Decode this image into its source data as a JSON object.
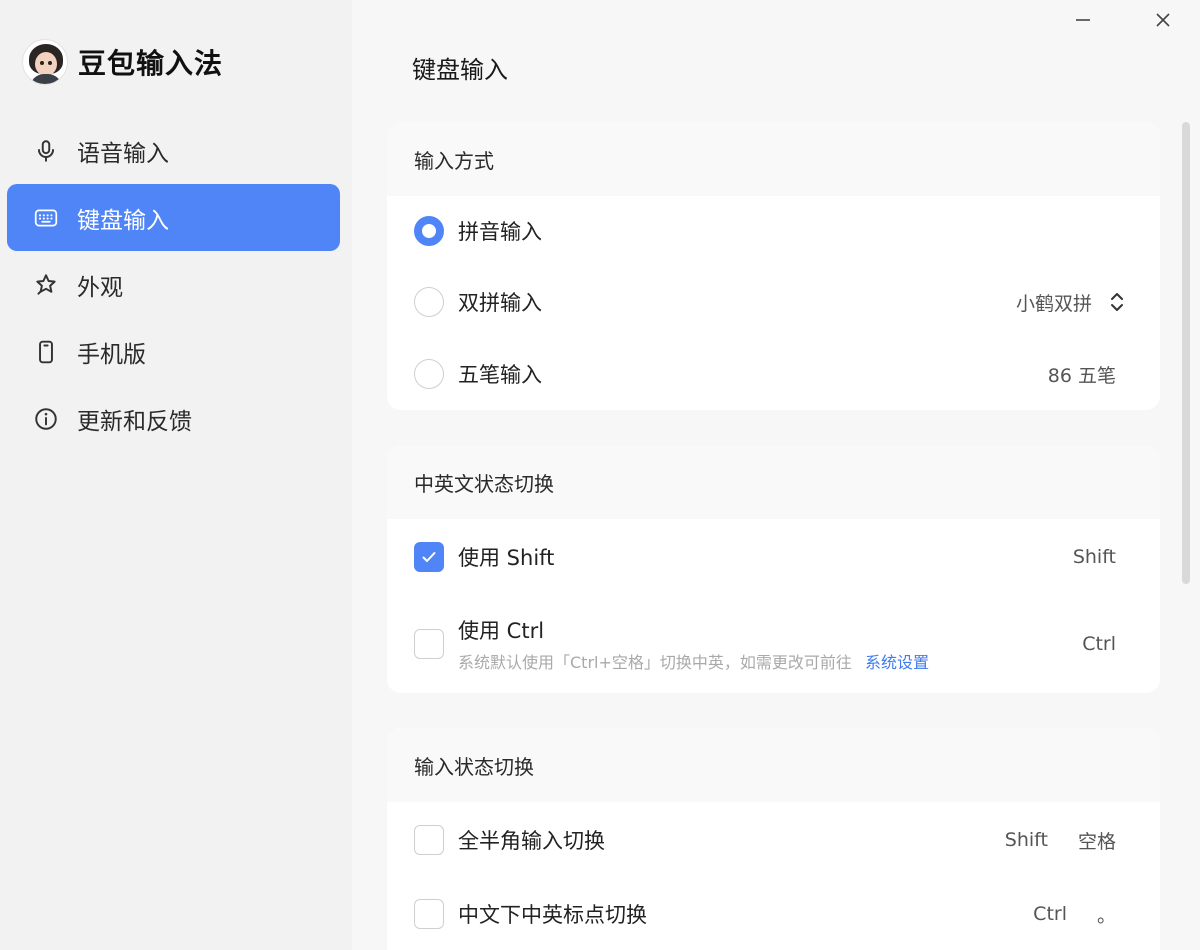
{
  "app": {
    "name": "豆包输入法"
  },
  "sidebar": {
    "items": [
      {
        "label": "语音输入",
        "icon": "microphone-icon"
      },
      {
        "label": "键盘输入",
        "icon": "keyboard-icon",
        "active": true
      },
      {
        "label": "外观",
        "icon": "star-outline-icon"
      },
      {
        "label": "手机版",
        "icon": "phone-icon"
      },
      {
        "label": "更新和反馈",
        "icon": "info-icon"
      }
    ]
  },
  "main": {
    "title": "键盘输入",
    "input_method": {
      "heading": "输入方式",
      "options": [
        {
          "label": "拼音输入",
          "selected": true
        },
        {
          "label": "双拼输入",
          "selected": false,
          "value": "小鹤双拼"
        },
        {
          "label": "五笔输入",
          "selected": false,
          "value": "86 五笔"
        }
      ]
    },
    "cn_en_switch": {
      "heading": "中英文状态切换",
      "options": [
        {
          "label": "使用 Shift",
          "checked": true,
          "key": "Shift"
        },
        {
          "label": "使用 Ctrl",
          "checked": false,
          "key": "Ctrl",
          "note": "系统默认使用「Ctrl+空格」切换中英，如需更改可前往",
          "link": "系统设置"
        }
      ]
    },
    "state_switch": {
      "heading": "输入状态切换",
      "options": [
        {
          "label": "全半角输入切换",
          "checked": false,
          "key1": "Shift",
          "key2": "空格"
        },
        {
          "label": "中文下中英标点切换",
          "checked": false,
          "key1": "Ctrl",
          "key2": "。"
        }
      ]
    }
  },
  "colors": {
    "accent": "#4f85f6",
    "link": "#3f7bf2"
  }
}
